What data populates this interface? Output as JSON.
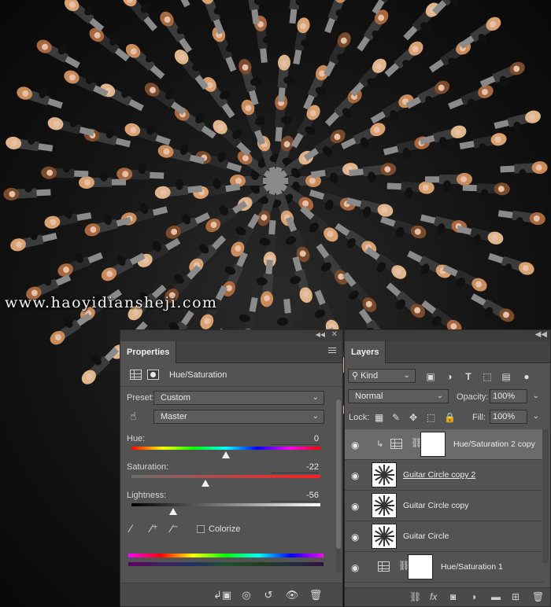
{
  "canvas": {
    "watermark": "www.haoyidiansheji.com"
  },
  "properties": {
    "tab_label": "Properties",
    "adjustment_title": "Hue/Saturation",
    "preset_label": "Preset:",
    "preset_value": "Custom",
    "channel_value": "Master",
    "hue": {
      "label": "Hue:",
      "value": "0",
      "level": 0
    },
    "saturation": {
      "label": "Saturation:",
      "value": "-22",
      "level": -22
    },
    "lightness": {
      "label": "Lightness:",
      "value": "-56",
      "level": -56
    },
    "colorize_label": "Colorize",
    "colorize_checked": false
  },
  "layers": {
    "tab_label": "Layers",
    "kind_value": "Kind",
    "blend_mode": "Normal",
    "opacity_label": "Opacity:",
    "opacity_value": "100%",
    "lock_label": "Lock:",
    "fill_label": "Fill:",
    "fill_value": "100%",
    "items": [
      {
        "name": "Hue/Saturation 2 copy",
        "type": "adjustment",
        "clipped": true,
        "selected": true,
        "visible": true
      },
      {
        "name": "Guitar Circle copy 2",
        "type": "pixel",
        "underlined": true,
        "visible": true
      },
      {
        "name": "Guitar Circle copy",
        "type": "pixel",
        "visible": true
      },
      {
        "name": "Guitar Circle",
        "type": "pixel",
        "visible": true
      },
      {
        "name": "Hue/Saturation 1",
        "type": "adjustment",
        "visible": true
      }
    ]
  },
  "icons": {
    "layers_footer": [
      "link-icon",
      "fx-icon",
      "add-mask-icon",
      "new-fill-adjustment-icon",
      "folder-icon",
      "new-layer-icon",
      "trash-icon"
    ],
    "properties_footer": [
      "clip-to-layer-icon",
      "view-previous-icon",
      "reset-icon",
      "visibility-icon",
      "trash-icon"
    ]
  }
}
